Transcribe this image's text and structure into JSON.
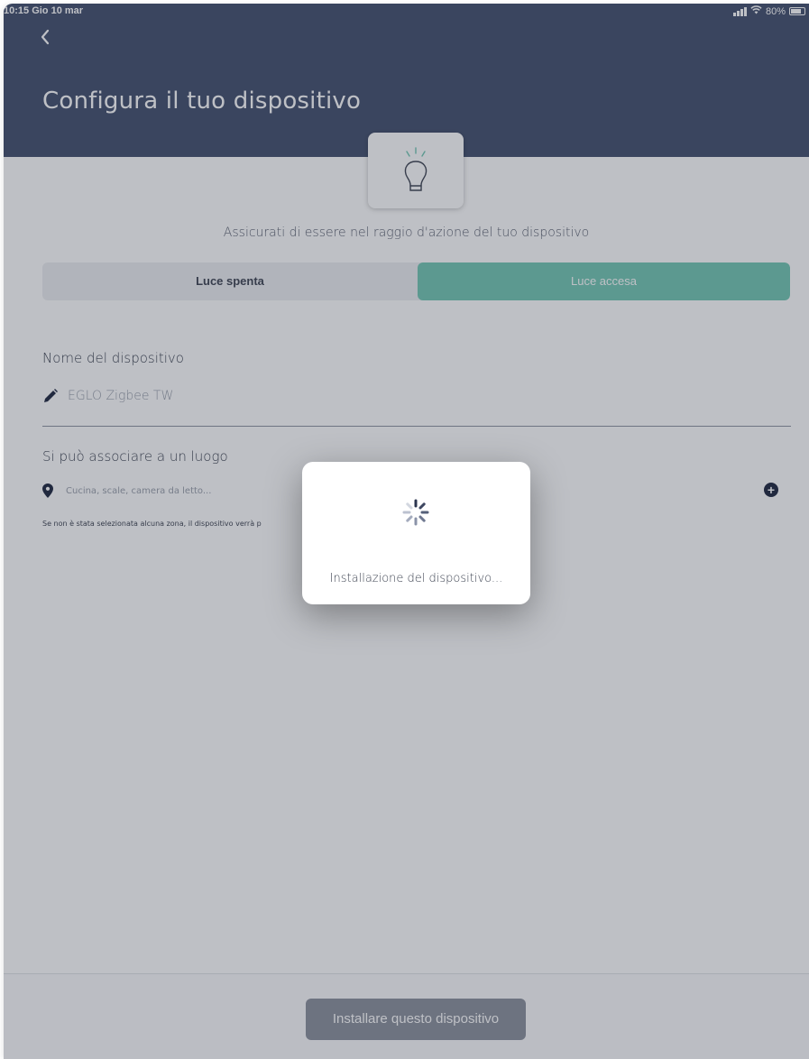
{
  "status_bar": {
    "time": "10:15  Gio 10 mar",
    "battery": "80%",
    "wifi_icon": "wifi-icon",
    "signal_icon": "signal-icon"
  },
  "header": {
    "back_icon": "chevron-left-icon",
    "title": "Configura il tuo dispositivo",
    "bulb_icon": "lightbulb-icon"
  },
  "instruction": "Assicurati di essere nel raggio d'azione del tuo dispositivo",
  "light_toggle": {
    "off_label": "Luce spenta",
    "on_label": "Luce accesa",
    "selected": "Luce accesa"
  },
  "device_name": {
    "label": "Nome del dispositivo",
    "value": "EGLO Zigbee TW",
    "icon": "pencil-icon"
  },
  "location": {
    "label": "Si può associare a un luogo",
    "placeholder": "Cucina, scale, camera da letto...",
    "icon": "map-pin-icon",
    "add_icon": "plus-circle-icon",
    "hint": "Se non è stata selezionata alcuna zona, il dispositivo verrà p"
  },
  "install_button": {
    "label": "Installare questo dispositivo"
  },
  "loading_dialog": {
    "icon": "spinner-icon",
    "message": "Installazione del dispositivo..."
  },
  "colors": {
    "header_bg": "#43506e",
    "accent_green": "#73c8b4",
    "text_dark": "#3e4452",
    "button_disabled": "#8c919d"
  }
}
